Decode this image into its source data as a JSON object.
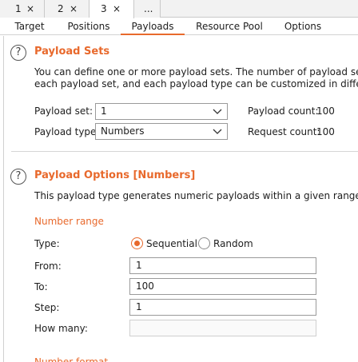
{
  "attack_tabs": [
    {
      "label": "1",
      "close": "×"
    },
    {
      "label": "2",
      "close": "×"
    },
    {
      "label": "3",
      "close": "×"
    },
    {
      "label": "..."
    }
  ],
  "sub_tabs": [
    "Target",
    "Positions",
    "Payloads",
    "Resource Pool",
    "Options"
  ],
  "active_sub_tab": "Payloads",
  "payload_sets": {
    "help_glyph": "?",
    "title": "Payload Sets",
    "description_line1": "You can define one or more payload sets. The number of payload sets depe",
    "description_line2": "each payload set, and each payload type can be customized in different way",
    "payload_set_label": "Payload set:",
    "payload_set_value": "1",
    "payload_type_label": "Payload type:",
    "payload_type_value": "Numbers",
    "payload_count_label": "Payload count:",
    "payload_count_value": "100",
    "request_count_label": "Request count:",
    "request_count_value": "100"
  },
  "payload_options": {
    "help_glyph": "?",
    "title": "Payload Options [Numbers]",
    "description": "This payload type generates numeric payloads within a given range and in a",
    "number_range_heading": "Number range",
    "type_label": "Type:",
    "type_options": [
      "Sequential",
      "Random"
    ],
    "type_selected": "Sequential",
    "from_label": "From:",
    "from_value": "1",
    "to_label": "To:",
    "to_value": "100",
    "step_label": "Step:",
    "step_value": "1",
    "how_many_label": "How many:",
    "how_many_value": "",
    "number_format_heading": "Number format"
  },
  "colors": {
    "accent": "#e8692c"
  }
}
